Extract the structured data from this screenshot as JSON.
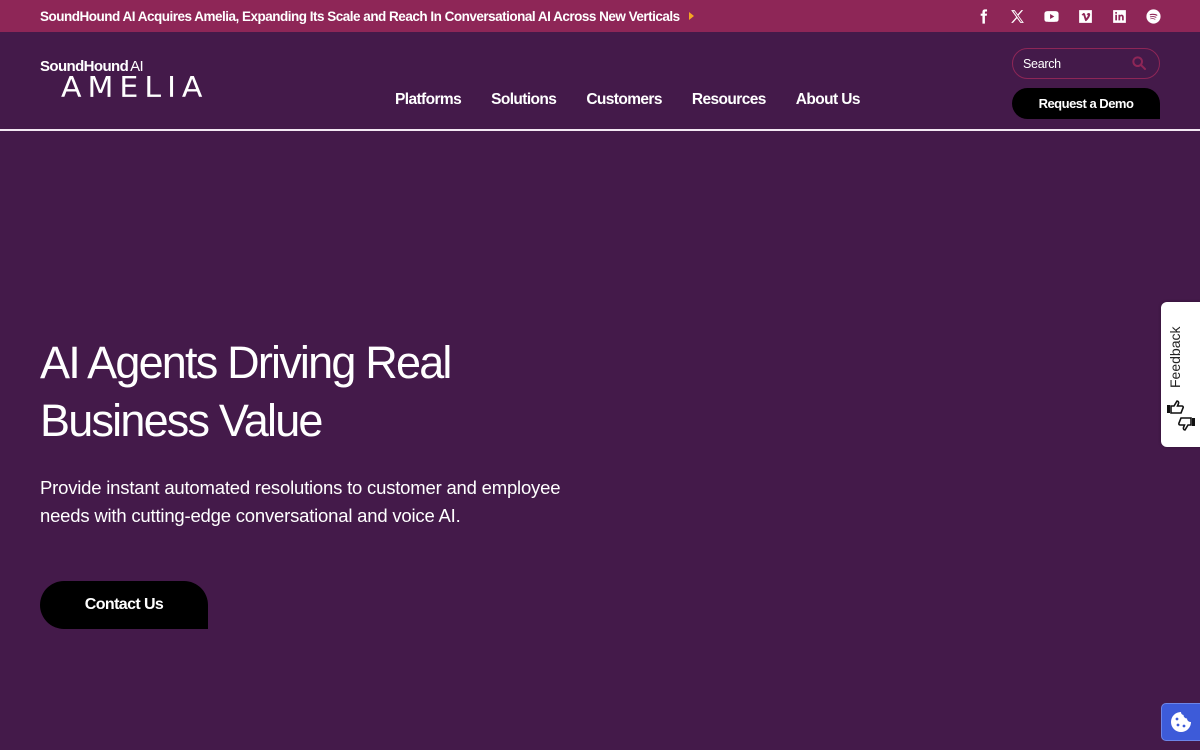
{
  "topbar": {
    "announcement": "SoundHound AI Acquires Amelia, Expanding Its Scale and Reach In Conversational AI Across New Verticals",
    "announcement_arrow_icon": "caret-right-icon",
    "accent_color": "#f5a623",
    "background": "#8e2657",
    "socials": [
      {
        "name": "facebook",
        "icon": "facebook-icon"
      },
      {
        "name": "x",
        "icon": "x-twitter-icon"
      },
      {
        "name": "youtube",
        "icon": "youtube-icon"
      },
      {
        "name": "vimeo",
        "icon": "vimeo-icon"
      },
      {
        "name": "linkedin",
        "icon": "linkedin-icon"
      },
      {
        "name": "spotify",
        "icon": "spotify-icon"
      }
    ]
  },
  "header": {
    "logo": {
      "brand": "SoundHound",
      "brand_suffix": "AI",
      "product": "AMELIA"
    },
    "nav": [
      "Platforms",
      "Solutions",
      "Customers",
      "Resources",
      "About Us"
    ],
    "search": {
      "placeholder": "Search",
      "value": ""
    },
    "demo_button": "Request a Demo"
  },
  "hero": {
    "title": "AI Agents Driving Real Business Value",
    "subtitle": "Provide instant automated resolutions to customer and employee needs with cutting-edge conversational and voice AI.",
    "cta": "Contact Us",
    "background": "#441a4a"
  },
  "feedback_tab": {
    "label": "Feedback"
  },
  "cookie_button": {
    "icon": "cookie-icon",
    "color": "#3d5bd9"
  }
}
